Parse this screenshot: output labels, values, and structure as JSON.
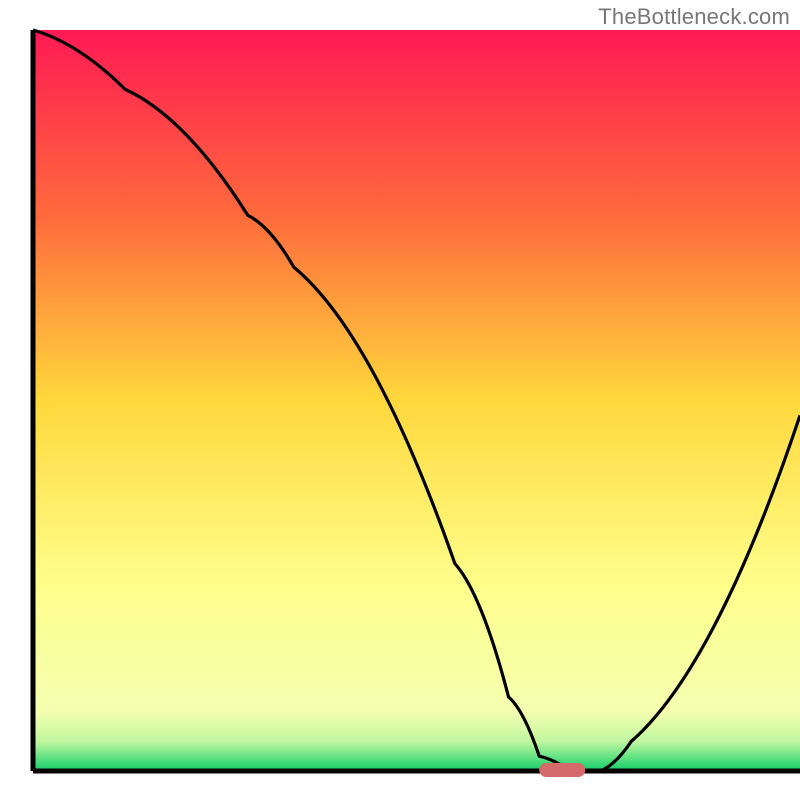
{
  "watermark": "TheBottleneck.com",
  "axis_color": "#000000",
  "curve_color": "#000000",
  "target_color": "#d46a6a",
  "chart_data": {
    "type": "line",
    "title": "",
    "xlabel": "",
    "ylabel": "",
    "xlim": [
      0,
      100
    ],
    "ylim": [
      0,
      100
    ],
    "gradient_bands": [
      {
        "y_percent": 0,
        "color": "#ff1a54"
      },
      {
        "y_percent": 25,
        "color": "#ff6a3c"
      },
      {
        "y_percent": 50,
        "color": "#ffd83c"
      },
      {
        "y_percent": 75,
        "color": "#ffff8c"
      },
      {
        "y_percent": 92,
        "color": "#f4ffb0"
      },
      {
        "y_percent": 96,
        "color": "#c1f7a0"
      },
      {
        "y_percent": 99,
        "color": "#3bd977"
      },
      {
        "y_percent": 100,
        "color": "#19c96b"
      }
    ],
    "series": [
      {
        "name": "bottleneck-curve",
        "x": [
          0,
          12,
          28,
          34,
          55,
          62,
          66,
          70,
          74,
          78,
          100
        ],
        "y_percent": [
          100,
          92,
          75,
          68,
          28,
          10,
          2,
          0,
          0,
          4,
          48
        ]
      }
    ],
    "target_marker": {
      "x_start_percent": 66,
      "x_end_percent": 72,
      "y_percent": 0
    }
  }
}
